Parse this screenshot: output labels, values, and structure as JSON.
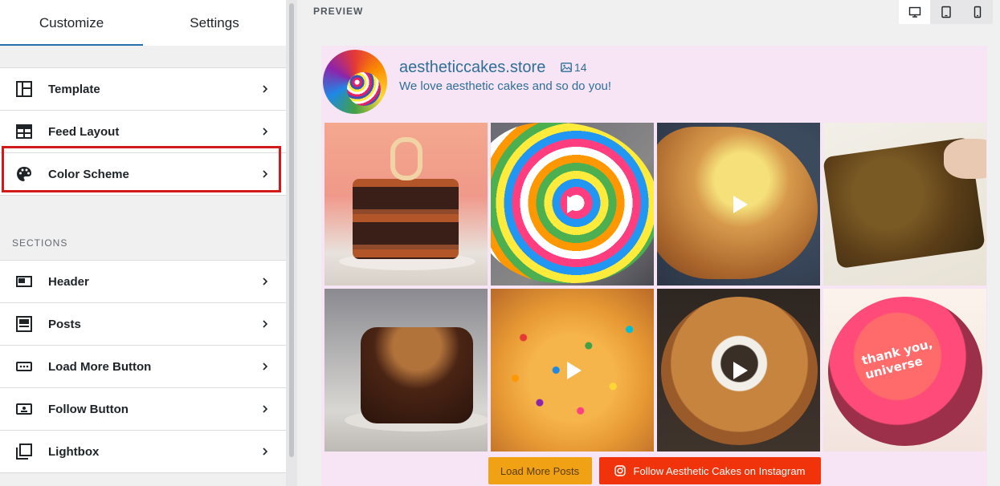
{
  "tabs": [
    {
      "label": "Customize",
      "active": true
    },
    {
      "label": "Settings",
      "active": false
    }
  ],
  "menu": {
    "items": [
      {
        "label": "Template",
        "icon": "template-icon"
      },
      {
        "label": "Feed Layout",
        "icon": "feed-layout-icon"
      },
      {
        "label": "Color Scheme",
        "icon": "palette-icon",
        "highlighted": true
      }
    ]
  },
  "sections": {
    "title": "SECTIONS",
    "items": [
      {
        "label": "Header",
        "icon": "header-icon"
      },
      {
        "label": "Posts",
        "icon": "posts-icon"
      },
      {
        "label": "Load More Button",
        "icon": "load-more-icon"
      },
      {
        "label": "Follow Button",
        "icon": "follow-button-icon"
      },
      {
        "label": "Lightbox",
        "icon": "lightbox-icon"
      }
    ]
  },
  "preview": {
    "label": "PREVIEW",
    "devices": [
      "desktop-icon",
      "tablet-icon",
      "mobile-icon"
    ],
    "active_device": "desktop"
  },
  "feed": {
    "username": "aestheticcakes.store",
    "post_count": "14",
    "bio": "We love aesthetic cakes and so do you!",
    "posts": [
      {
        "type": "image",
        "subject": "chocolate layer cake with 10 candle"
      },
      {
        "type": "video",
        "subject": "rainbow swiss roll"
      },
      {
        "type": "video",
        "subject": "cake slice with custard"
      },
      {
        "type": "image",
        "subject": "brownie bar"
      },
      {
        "type": "image",
        "subject": "caramel nut cake"
      },
      {
        "type": "video",
        "subject": "sprinkle cake"
      },
      {
        "type": "video",
        "subject": "glazed bundt cake"
      },
      {
        "type": "image",
        "subject": "thank you universe cake",
        "text": "thank you, universe"
      }
    ],
    "load_more_label": "Load More Posts",
    "follow_label": "Follow Aesthetic Cakes on Instagram"
  },
  "colors": {
    "highlight": "#d11a1a",
    "feed_background": "#f7e5f5",
    "load_more": "#f0a114",
    "follow": "#f0330a",
    "link": "#2f6f96"
  }
}
